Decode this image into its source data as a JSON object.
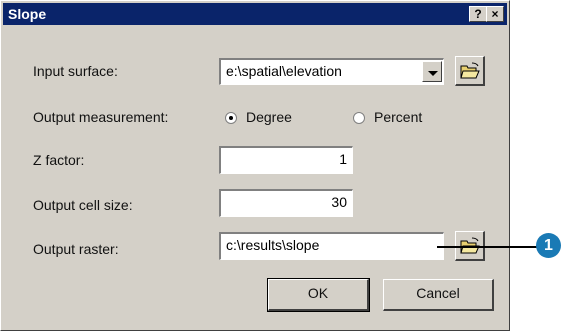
{
  "dialog": {
    "title": "Slope",
    "help_label": "?",
    "close_label": "×"
  },
  "form": {
    "input_surface_label": "Input surface:",
    "input_surface_value": "e:\\spatial\\elevation",
    "output_measurement_label": "Output measurement:",
    "measurement_options": [
      "Degree",
      "Percent"
    ],
    "measurement_selected": "Degree",
    "z_factor_label": "Z factor:",
    "z_factor_value": "1",
    "cell_size_label": "Output cell size:",
    "cell_size_value": "30",
    "output_raster_label": "Output raster:",
    "output_raster_value": "c:\\results\\slope"
  },
  "buttons": {
    "ok": "OK",
    "cancel": "Cancel"
  },
  "callout": {
    "number": "1",
    "color": "#1a7ab5"
  },
  "icons": [
    "open-folder-icon",
    "chevron-down-icon",
    "help-icon",
    "close-icon"
  ]
}
